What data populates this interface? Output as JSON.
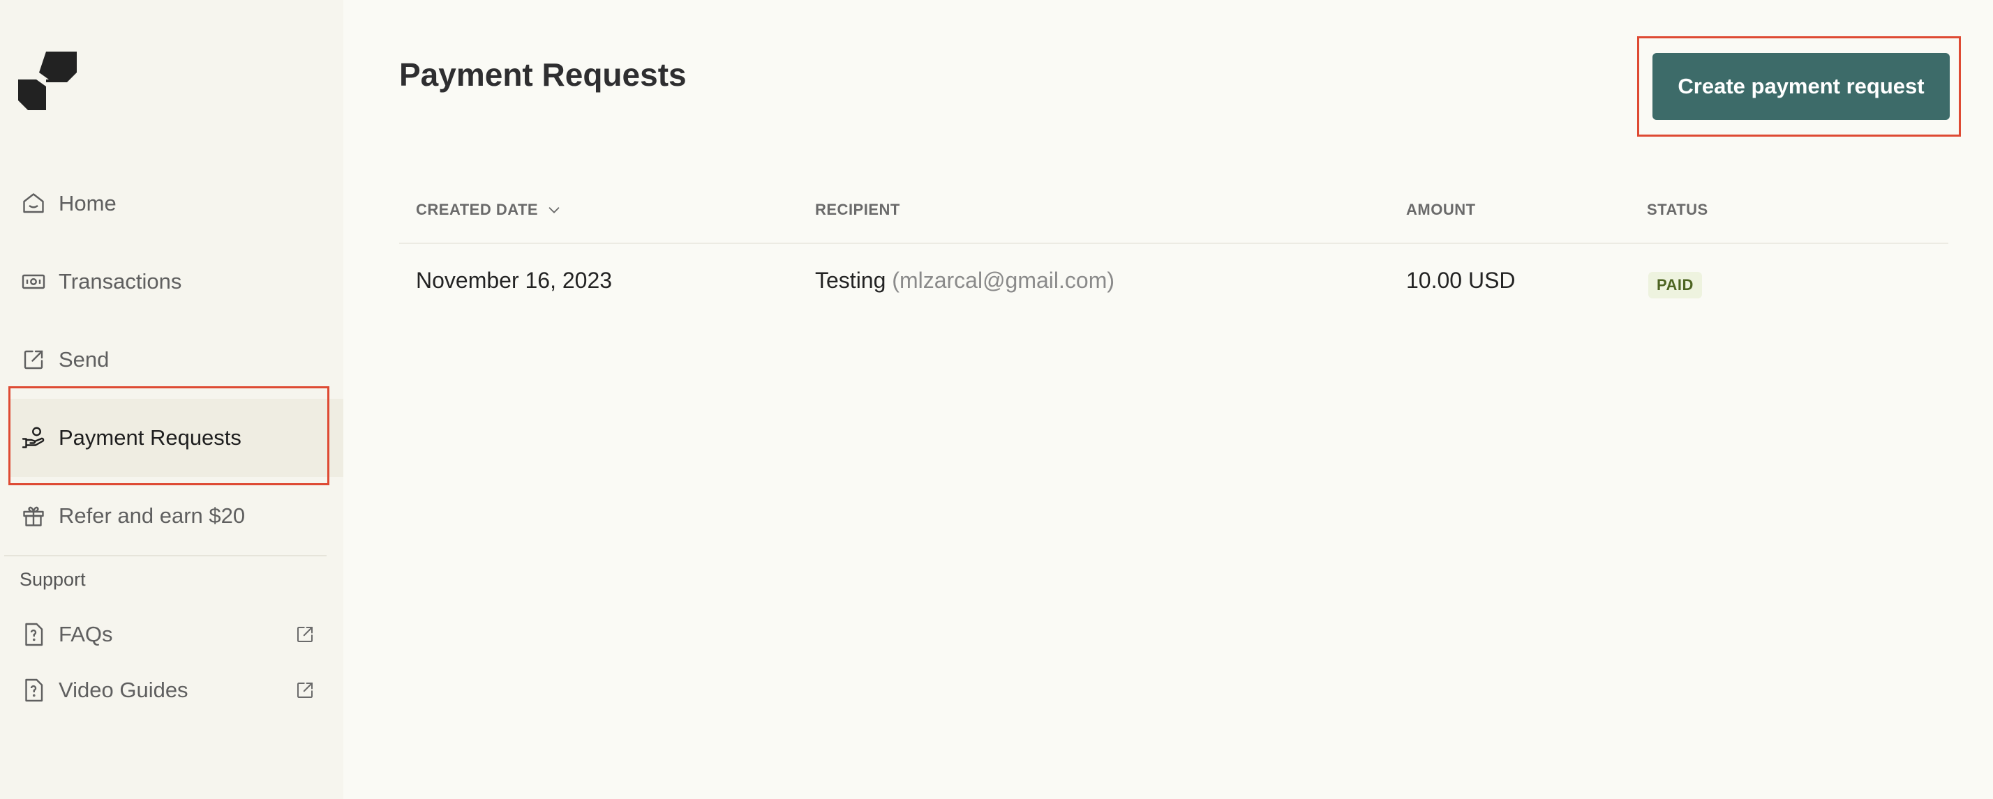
{
  "sidebar": {
    "items": [
      {
        "label": "Home",
        "icon": "home-icon"
      },
      {
        "label": "Transactions",
        "icon": "banknote-icon"
      },
      {
        "label": "Send",
        "icon": "external-send-icon"
      },
      {
        "label": "Payment Requests",
        "icon": "hand-coin-icon",
        "active": true
      },
      {
        "label": "Refer and earn $20",
        "icon": "gift-icon"
      }
    ],
    "support_heading": "Support",
    "support_items": [
      {
        "label": "FAQs",
        "icon": "help-doc-icon"
      },
      {
        "label": "Video Guides",
        "icon": "help-doc-icon"
      }
    ]
  },
  "main": {
    "title": "Payment Requests",
    "create_button": "Create payment request",
    "table": {
      "columns": [
        "CREATED DATE",
        "RECIPIENT",
        "AMOUNT",
        "STATUS"
      ],
      "rows": [
        {
          "created_date": "November 16, 2023",
          "recipient_name": "Testing",
          "recipient_email": "(mlzarcal@gmail.com)",
          "amount": "10.00 USD",
          "status": "PAID"
        }
      ]
    }
  },
  "colors": {
    "accent_button": "#3d6b69",
    "highlight_box": "#de4a33",
    "paid_badge_bg": "#eef3df",
    "paid_badge_text": "#4d6422"
  }
}
